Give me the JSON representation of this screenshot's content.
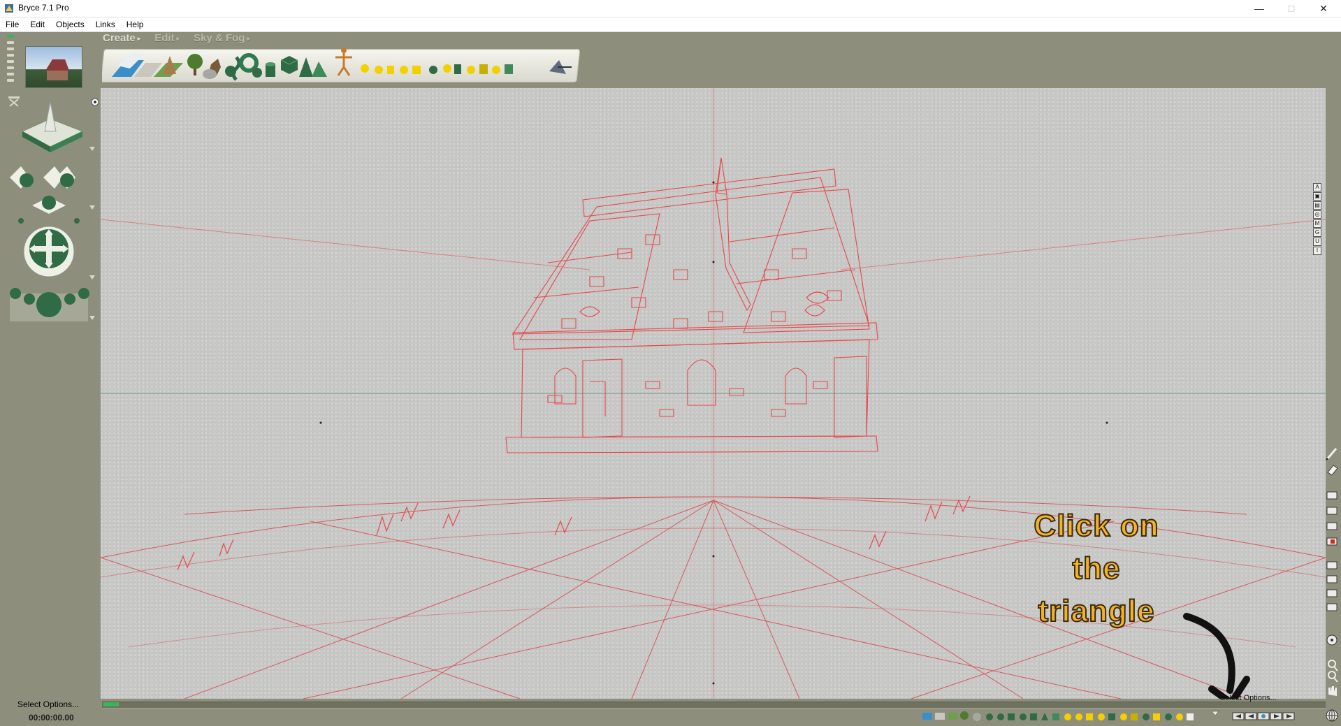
{
  "window": {
    "title": "Bryce 7.1  Pro",
    "minimize_glyph": "—",
    "maximize_glyph": "□",
    "close_glyph": "✕"
  },
  "menu": {
    "items": [
      {
        "label": "File"
      },
      {
        "label": "Edit"
      },
      {
        "label": "Objects"
      },
      {
        "label": "Links"
      },
      {
        "label": "Help"
      }
    ]
  },
  "palette_tabs": [
    {
      "label": "Create",
      "active": true
    },
    {
      "label": "Edit",
      "active": false
    },
    {
      "label": "Sky & Fog",
      "active": false
    }
  ],
  "arrow_glyph": "▸",
  "left_panel": {
    "status_text": "Select Options...",
    "time_code": "00:00:00.00"
  },
  "view_controls": {
    "letters": [
      "A",
      "▣",
      "▤",
      "◎",
      "M",
      "G",
      "U",
      "I"
    ]
  },
  "viewport": {
    "annotation_lines": [
      "Click on",
      "the",
      "triangle"
    ],
    "wire_color": "#e8474a",
    "ground_color": "#d94548"
  },
  "bottom": {
    "select_options_label": "Select Options..."
  },
  "colors": {
    "workspace_bg": "#8d8f7c",
    "viewport_bg": "#c8c8c6",
    "annotation_fill": "#f4b324",
    "timeline_start": "#3eb25a"
  }
}
